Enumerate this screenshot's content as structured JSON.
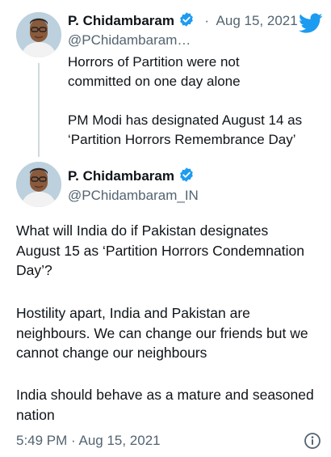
{
  "quoted_tweet": {
    "author_name": "P. Chidambaram",
    "handle": "@PChidambaram…",
    "separator": "·",
    "date": "Aug 15, 2021",
    "paragraphs": [
      "Horrors of Partition were not\ncommitted on one day alone",
      "PM Modi has designated August 14 as\n‘Partition Horrors Remembrance Day’"
    ]
  },
  "main_tweet": {
    "author_name": "P. Chidambaram",
    "handle": "@PChidambaram_IN",
    "paragraphs": [
      "What will India do if Pakistan designates\nAugust 15 as ‘Partition Horrors Condemnation\nDay’?",
      "Hostility apart, India and Pakistan are\nneighbours. We can change our friends but we\ncannot change our neighbours",
      "India should behave as a mature and seasoned\nnation"
    ],
    "timestamp": "5:49 PM · Aug 15, 2021"
  },
  "colors": {
    "brand_blue": "#1d9bf0",
    "text": "#0f1419",
    "secondary": "#536471"
  },
  "icons": {
    "twitter": "twitter-bird-icon",
    "verified": "verified-badge-icon",
    "info": "info-icon"
  }
}
